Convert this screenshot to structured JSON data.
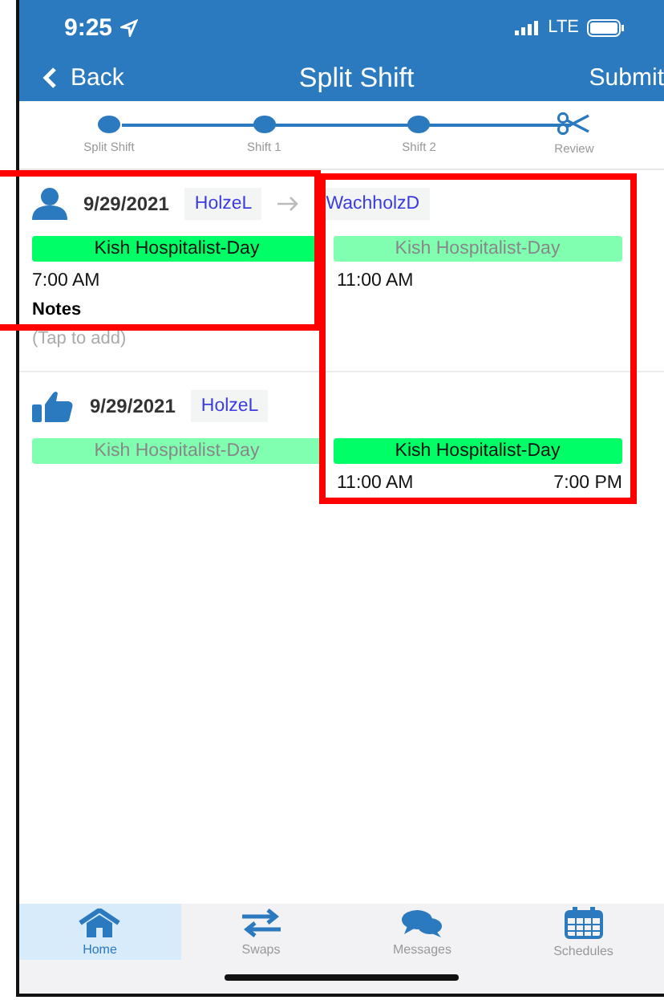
{
  "status_bar": {
    "time": "9:25",
    "network": "LTE"
  },
  "nav": {
    "back": "Back",
    "title": "Split Shift",
    "action": "Submit"
  },
  "steps": [
    {
      "label": "Split Shift",
      "kind": "dot"
    },
    {
      "label": "Shift 1",
      "kind": "dot"
    },
    {
      "label": "Shift 2",
      "kind": "dot"
    },
    {
      "label": "Review",
      "kind": "scissors"
    }
  ],
  "shifts": [
    {
      "kind": "person",
      "date": "9/29/2021",
      "users": [
        "HolzeL",
        "WachholzD"
      ],
      "bars": [
        {
          "label": "Kish Hospitalist-Day",
          "active": true
        },
        {
          "label": "Kish Hospitalist-Day",
          "active": false
        }
      ],
      "times": [
        {
          "text": "7:00 AM",
          "kind": "start"
        },
        {
          "text": "11:00 AM",
          "kind": "split"
        }
      ],
      "notes": {
        "label": "Notes",
        "placeholder": "(Tap to add)"
      }
    },
    {
      "kind": "thumbs",
      "date": "9/29/2021",
      "users": [
        "HolzeL"
      ],
      "bars": [
        {
          "label": "Kish Hospitalist-Day",
          "active": false
        },
        {
          "label": "Kish Hospitalist-Day",
          "active": true
        }
      ],
      "times": [
        {
          "text": "11:00 AM",
          "kind": "split"
        },
        {
          "text": "7:00 PM",
          "kind": "end"
        }
      ]
    }
  ],
  "tabs": [
    {
      "label": "Home",
      "kind": "home",
      "selected": true
    },
    {
      "label": "Swaps",
      "kind": "swaps",
      "selected": false
    },
    {
      "label": "Messages",
      "kind": "messages",
      "selected": false
    },
    {
      "label": "Schedules",
      "kind": "calendar",
      "selected": false
    }
  ]
}
